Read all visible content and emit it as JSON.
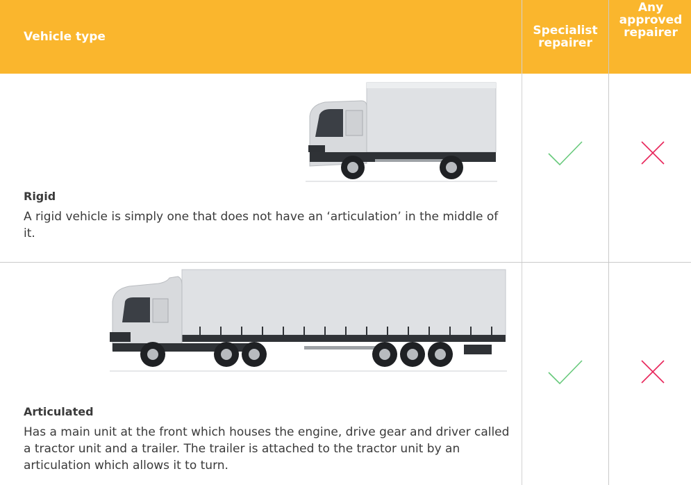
{
  "header": {
    "vehicle_type": "Vehicle type",
    "specialist_repairer": "Specialist repairer",
    "any_approved_repairer": "Any approved repairer"
  },
  "rows": [
    {
      "title": "Rigid",
      "description": "A rigid vehicle is simply one that does not have an ‘articulation’ in the middle of it.",
      "specialist": "check-icon",
      "any_approved": "cross-icon"
    },
    {
      "title": "Articulated",
      "description": "Has a main unit at the front which houses the engine, drive gear and driver called a tractor unit and a trailer. The trailer is attached to the tractor unit by an articulation which allows it to turn.",
      "specialist": "check-icon",
      "any_approved": "cross-icon"
    }
  ],
  "colors": {
    "header_bg": "#FAB62D",
    "check": "#67C97B",
    "cross": "#E8255A",
    "text": "#3a3a3a"
  }
}
